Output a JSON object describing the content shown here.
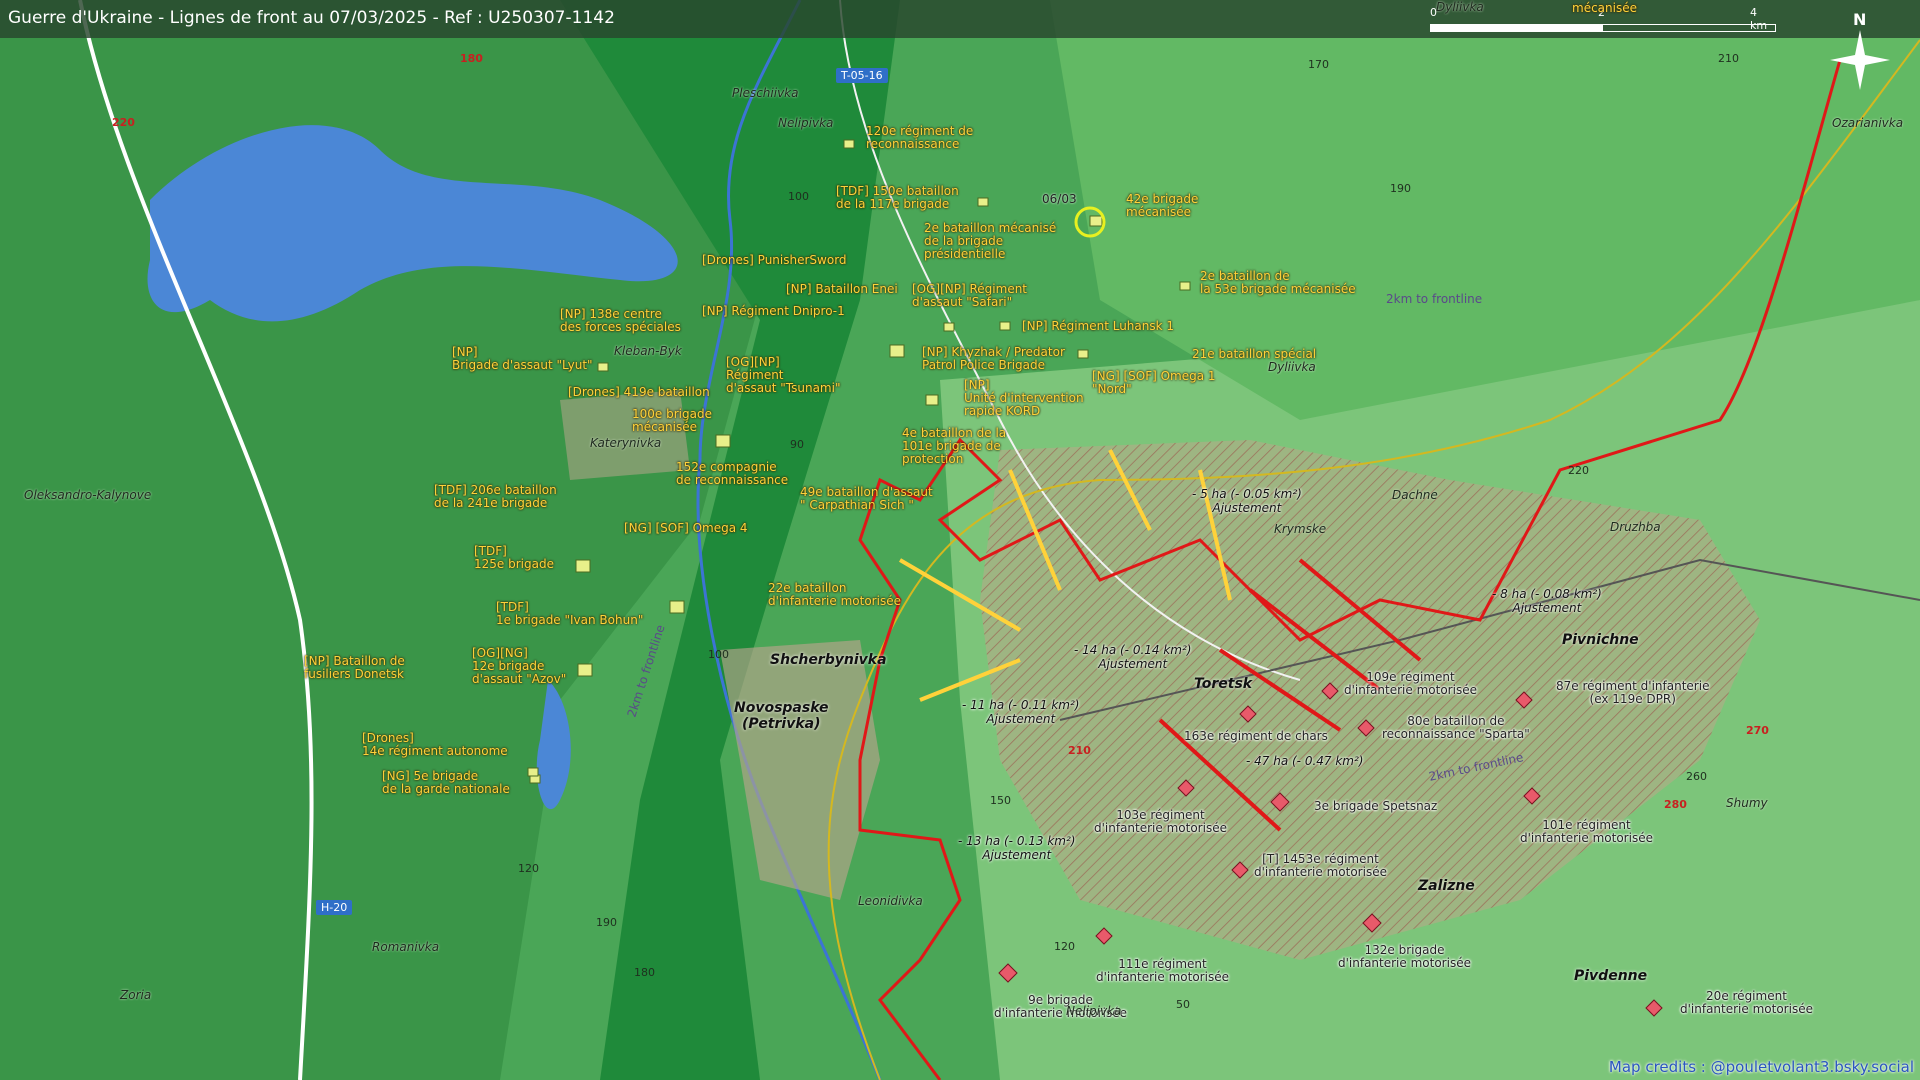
{
  "title": "Guerre d'Ukraine - Lignes de front au 07/03/2025 - Ref : U250307-1142",
  "scale": {
    "labels": [
      "0",
      "2",
      "4 km"
    ]
  },
  "compass": {
    "north": "N"
  },
  "credits": "Map credits : @pouletvolant3.bsky.social",
  "colors": {
    "ukraine_units": "#ffd23a",
    "russia_units": "#e85a6a",
    "frontline": "#e01818",
    "prior_line": "#d4b820",
    "lake": "#4b87d6"
  },
  "ukrainian_units": [
    "120e régiment de\nreconnaissance",
    "[TDF] 150e bataillon\nde la 117e brigade",
    "42e brigade\nmécanisée",
    "2e bataillon mécanisé\nde la brigade\nprésidentielle",
    "[Drones] PunisherSword",
    "2e bataillon de\nla 53e brigade mécanisée",
    "[NP] Bataillon Enei",
    "[OG][NP] Régiment\nd'assaut \"Safari\"",
    "[NP] 138e centre\ndes forces spéciales",
    "[NP] Régiment Dnipro-1",
    "[NP] Régiment Luhansk 1",
    "[NP]\nBrigade d'assaut \"Lyut\"",
    "[OG][NP]\nRégiment\nd'assaut \"Tsunami\"",
    "[NP] Khyzhak / Predator\nPatrol Police Brigade",
    "21e bataillon spécial",
    "[Drones] 419e bataillon",
    "100e brigade\nmécanisée",
    "[NP]\nUnité d'intervention\nrapide KORD",
    "[NG] [SOF] Omega 1\n\"Nord\"",
    "4e bataillon de la\n101e brigade de\nprotection",
    "152e compagnie\nde reconnaissance",
    "[TDF] 206e bataillon\nde la 241e brigade",
    "49e bataillon d'assaut\n\" Carpathian Sich \"",
    "[NG] [SOF] Omega 4",
    "[TDF]\n125e brigade",
    "22e bataillon\nd'infanterie motorisée",
    "[TDF]\n1e brigade \"Ivan Bohun\"",
    "[NP] Bataillon de\nfusiliers Donetsk",
    "[OG][NG]\n12e brigade\nd'assaut \"Azov\"",
    "[Drones]\n14e régiment autonome",
    "[NG] 5e brigade\nde la garde nationale"
  ],
  "russian_units": [
    "109e régiment\nd'infanterie motorisée",
    "87e régiment d'infanterie\n(ex 119e DPR)",
    "163e régiment de chars",
    "80e bataillon de\nreconnaissance \"Sparta\"",
    "3e brigade Spetsnaz",
    "101e régiment\nd'infanterie motorisée",
    "103e régiment\nd'infanterie motorisée",
    "[T] 1453e régiment\nd'infanterie motorisée",
    "132e brigade\nd'infanterie motorisée",
    "111e régiment\nd'infanterie motorisée",
    "9e brigade\nd'infanterie motorisée",
    "20e régiment\nd'infanterie motorisée"
  ],
  "adjustments": [
    "- 5 ha (- 0.05 km²)\nAjustement",
    "- 8 ha (- 0.08 km²)\nAjustement",
    "- 14 ha (- 0.14 km²)\nAjustement",
    "- 11 ha (- 0.11 km²)\nAjustement",
    "- 47 ha (- 0.47 km²)",
    "- 13 ha (- 0.13 km²)\nAjustement"
  ],
  "places": [
    "Pleschiivka",
    "Nelipivka",
    "Kleban-Byk",
    "Katerynivka",
    "Oleksandro-Kalynove",
    "Dyliivka",
    "Dachne",
    "Krymske",
    "Druzhba",
    "Ozarianivka",
    "Leonidivka",
    "Romanivka",
    "Zoria",
    "Shumy",
    "Nelipivka",
    "Dyliivka"
  ],
  "big_places": [
    "Shcherbynivka",
    "Novospaske\n(Petrivka)",
    "Toretsk",
    "Pivnichne",
    "Zalizne",
    "Pivdenne"
  ],
  "roads": [
    "T-05-16",
    "H-20"
  ],
  "elevations": [
    "180",
    "220",
    "100",
    "170",
    "190",
    "210",
    "90",
    "220",
    "100",
    "150",
    "120",
    "180",
    "190",
    "260",
    "210",
    "270",
    "280",
    "120",
    "50"
  ],
  "front_notes": [
    "2km to frontline",
    "2km to frontline",
    "2km to frontline"
  ],
  "misc": {
    "date_marker": "06/03",
    "top_edge_label": "mécanisée",
    "top_place": "Dyliivka"
  }
}
